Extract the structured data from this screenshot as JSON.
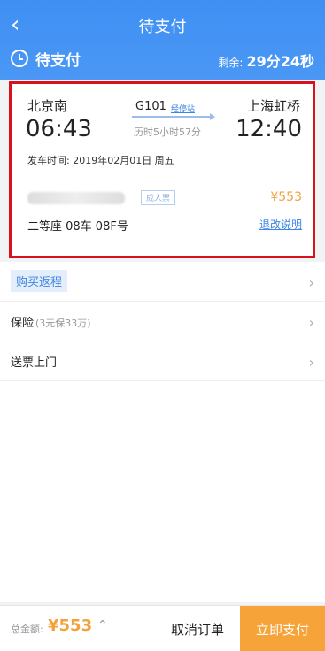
{
  "header": {
    "title": "待支付",
    "status": "待支付",
    "remaining_label": "剩余:",
    "remaining_time": "29分24秒"
  },
  "ticket": {
    "from_station": "北京南",
    "to_station": "上海虹桥",
    "dep_time": "06:43",
    "arr_time": "12:40",
    "train_no": "G101",
    "via_label": "经停站",
    "duration": "历时5小时57分",
    "dep_date": "发车时间: 2019年02月01日 周五",
    "passenger_type": "成人票",
    "price": "¥553",
    "seat": "二等座 08车 08F号",
    "refund_label": "退改说明"
  },
  "options": {
    "return_trip": "购买返程",
    "insurance": "保险",
    "insurance_desc": "(3元保33万)",
    "delivery": "送票上门"
  },
  "footer": {
    "total_label": "总金额:",
    "total_value": "¥553",
    "cancel_label": "取消订单",
    "pay_label": "立即支付"
  }
}
